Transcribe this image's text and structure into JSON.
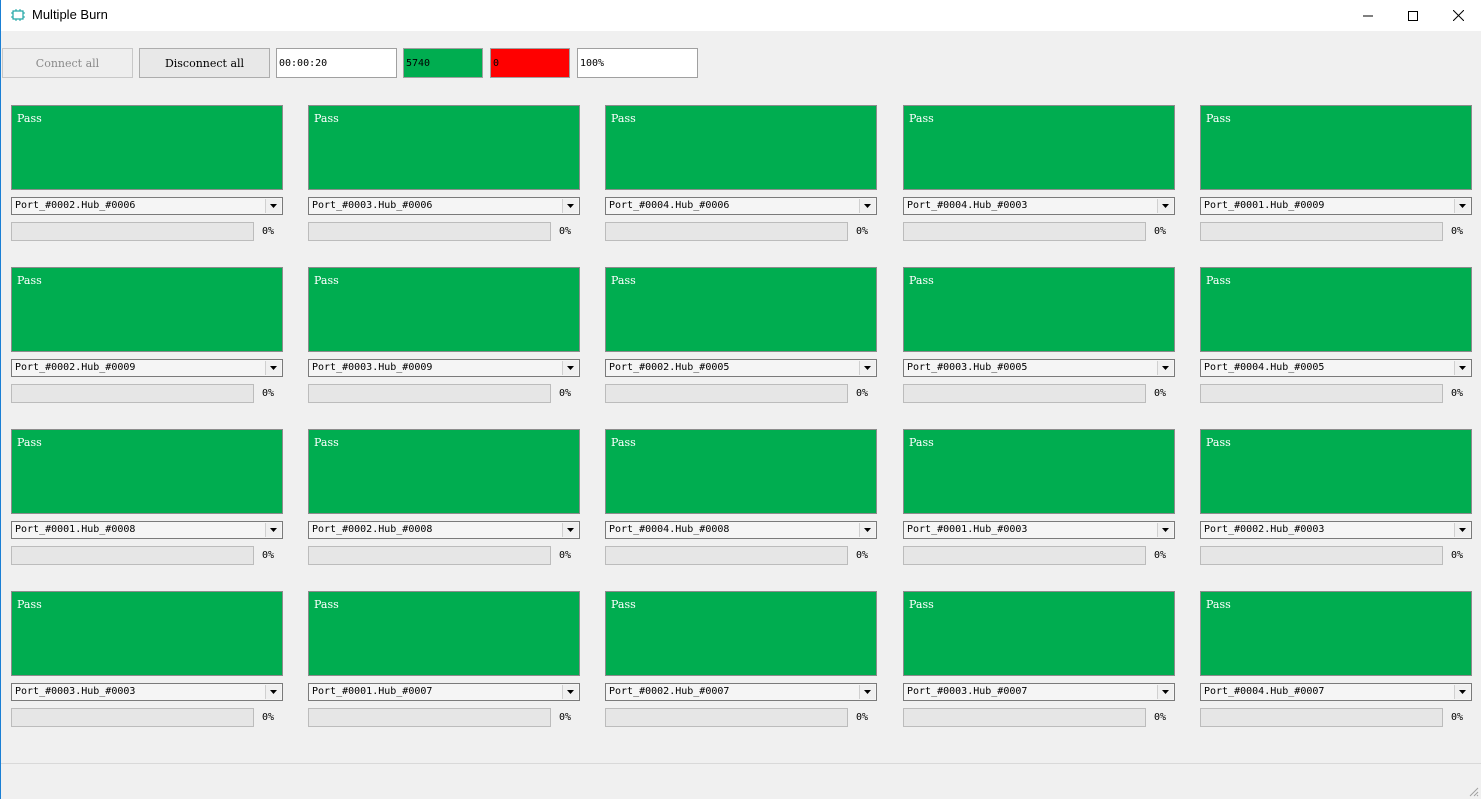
{
  "window": {
    "title": "Multiple Burn",
    "icons": {
      "app": "chip-icon",
      "minimize": "minimize-icon",
      "maximize": "maximize-icon",
      "close": "close-icon"
    }
  },
  "toolbar": {
    "connect_all_label": "Connect all",
    "disconnect_all_label": "Disconnect all",
    "elapsed_time": "00:00:20",
    "pass_count": "5740",
    "fail_count": "0",
    "total_progress": "100%",
    "pass_color": "#00ad50",
    "fail_color": "#ff0000"
  },
  "slots": [
    {
      "status": "Pass",
      "port": "Port_#0002.Hub_#0006",
      "progress_pct": 0,
      "progress_text": "0%"
    },
    {
      "status": "Pass",
      "port": "Port_#0003.Hub_#0006",
      "progress_pct": 0,
      "progress_text": "0%"
    },
    {
      "status": "Pass",
      "port": "Port_#0004.Hub_#0006",
      "progress_pct": 0,
      "progress_text": "0%"
    },
    {
      "status": "Pass",
      "port": "Port_#0004.Hub_#0003",
      "progress_pct": 0,
      "progress_text": "0%"
    },
    {
      "status": "Pass",
      "port": "Port_#0001.Hub_#0009",
      "progress_pct": 0,
      "progress_text": "0%"
    },
    {
      "status": "Pass",
      "port": "Port_#0002.Hub_#0009",
      "progress_pct": 0,
      "progress_text": "0%"
    },
    {
      "status": "Pass",
      "port": "Port_#0003.Hub_#0009",
      "progress_pct": 0,
      "progress_text": "0%"
    },
    {
      "status": "Pass",
      "port": "Port_#0002.Hub_#0005",
      "progress_pct": 0,
      "progress_text": "0%"
    },
    {
      "status": "Pass",
      "port": "Port_#0003.Hub_#0005",
      "progress_pct": 0,
      "progress_text": "0%"
    },
    {
      "status": "Pass",
      "port": "Port_#0004.Hub_#0005",
      "progress_pct": 0,
      "progress_text": "0%"
    },
    {
      "status": "Pass",
      "port": "Port_#0001.Hub_#0008",
      "progress_pct": 0,
      "progress_text": "0%"
    },
    {
      "status": "Pass",
      "port": "Port_#0002.Hub_#0008",
      "progress_pct": 0,
      "progress_text": "0%"
    },
    {
      "status": "Pass",
      "port": "Port_#0004.Hub_#0008",
      "progress_pct": 0,
      "progress_text": "0%"
    },
    {
      "status": "Pass",
      "port": "Port_#0001.Hub_#0003",
      "progress_pct": 0,
      "progress_text": "0%"
    },
    {
      "status": "Pass",
      "port": "Port_#0002.Hub_#0003",
      "progress_pct": 0,
      "progress_text": "0%"
    },
    {
      "status": "Pass",
      "port": "Port_#0003.Hub_#0003",
      "progress_pct": 0,
      "progress_text": "0%"
    },
    {
      "status": "Pass",
      "port": "Port_#0001.Hub_#0007",
      "progress_pct": 0,
      "progress_text": "0%"
    },
    {
      "status": "Pass",
      "port": "Port_#0002.Hub_#0007",
      "progress_pct": 0,
      "progress_text": "0%"
    },
    {
      "status": "Pass",
      "port": "Port_#0003.Hub_#0007",
      "progress_pct": 0,
      "progress_text": "0%"
    },
    {
      "status": "Pass",
      "port": "Port_#0004.Hub_#0007",
      "progress_pct": 0,
      "progress_text": "0%"
    }
  ]
}
